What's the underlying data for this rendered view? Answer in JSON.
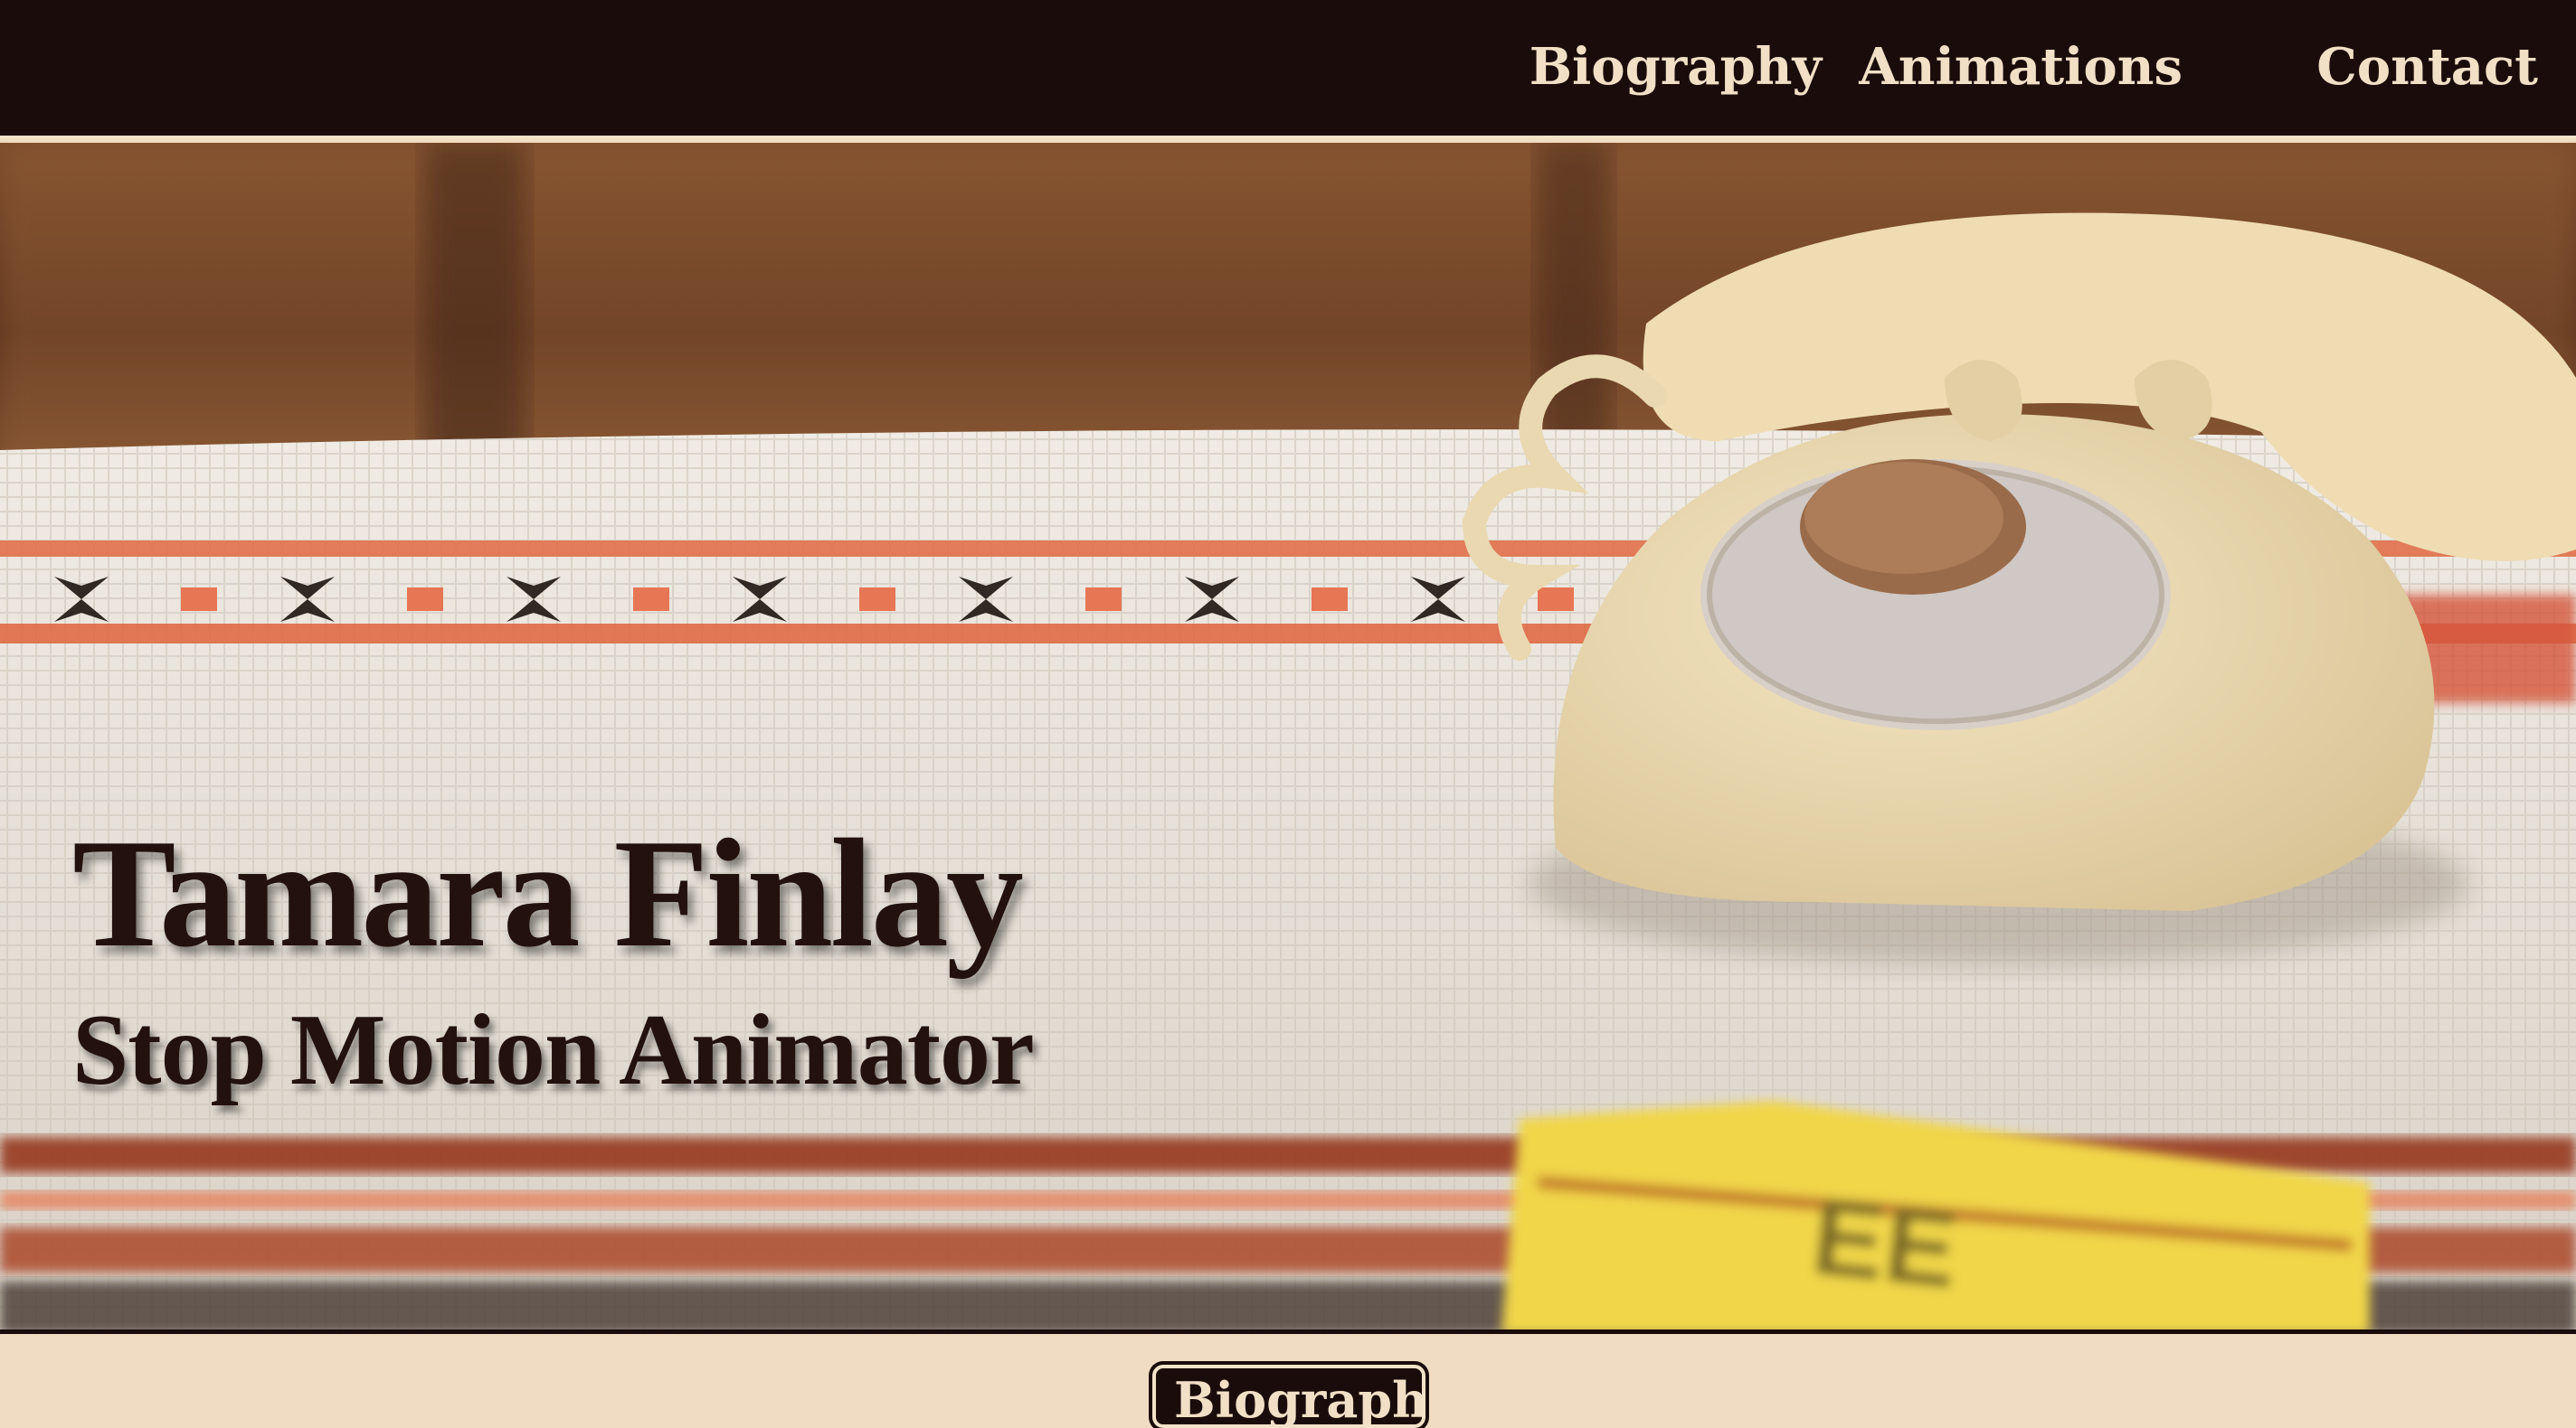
{
  "nav": {
    "items": [
      {
        "label": "Biography"
      },
      {
        "label": "Animations"
      },
      {
        "label": "Contact"
      }
    ]
  },
  "hero": {
    "title": "Tamara Finlay",
    "subtitle": "Stop Motion Animator",
    "image_icon": "hero-photo"
  },
  "section_tab": {
    "label": "Biography"
  },
  "colors": {
    "topbar": "#1a0c0a",
    "nav_text": "#f1dfc6",
    "page_bg": "#efdcc3",
    "hero_text": "#23110d"
  }
}
